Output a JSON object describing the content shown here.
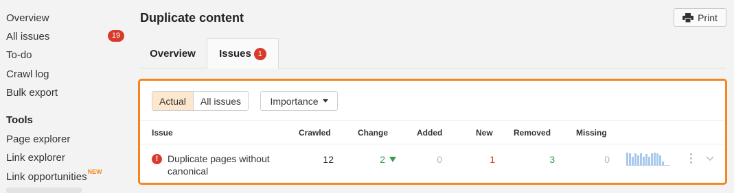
{
  "sidebar": {
    "items": [
      {
        "label": "Overview"
      },
      {
        "label": "All issues",
        "badge": "19"
      },
      {
        "label": "To-do"
      },
      {
        "label": "Crawl log"
      },
      {
        "label": "Bulk export"
      }
    ],
    "tools_heading": "Tools",
    "tools": [
      {
        "label": "Page explorer"
      },
      {
        "label": "Link explorer"
      },
      {
        "label": "Link opportunities",
        "tag": "NEW"
      }
    ]
  },
  "header": {
    "title": "Duplicate content",
    "print_label": "Print",
    "print_icon": "printer-icon"
  },
  "tabs": [
    {
      "label": "Overview",
      "active": false
    },
    {
      "label": "Issues",
      "badge": "1",
      "active": true
    }
  ],
  "filters": {
    "segments": [
      "Actual",
      "All issues"
    ],
    "active_segment": "Actual",
    "importance_label": "Importance"
  },
  "table": {
    "columns": [
      "Issue",
      "Crawled",
      "Change",
      "Added",
      "New",
      "Removed",
      "Missing"
    ],
    "rows": [
      {
        "issue": "Duplicate pages without canonical",
        "crawled": "12",
        "change": "2",
        "change_direction": "down",
        "added": "0",
        "new": "1",
        "removed": "3",
        "missing": "0"
      }
    ]
  },
  "colors": {
    "accent_orange": "#f5861f",
    "error_red": "#d93a2b",
    "positive_green": "#3c9a4a",
    "active_segment_bg": "#fde7cf",
    "spark_blue": "#a9c9ec"
  }
}
